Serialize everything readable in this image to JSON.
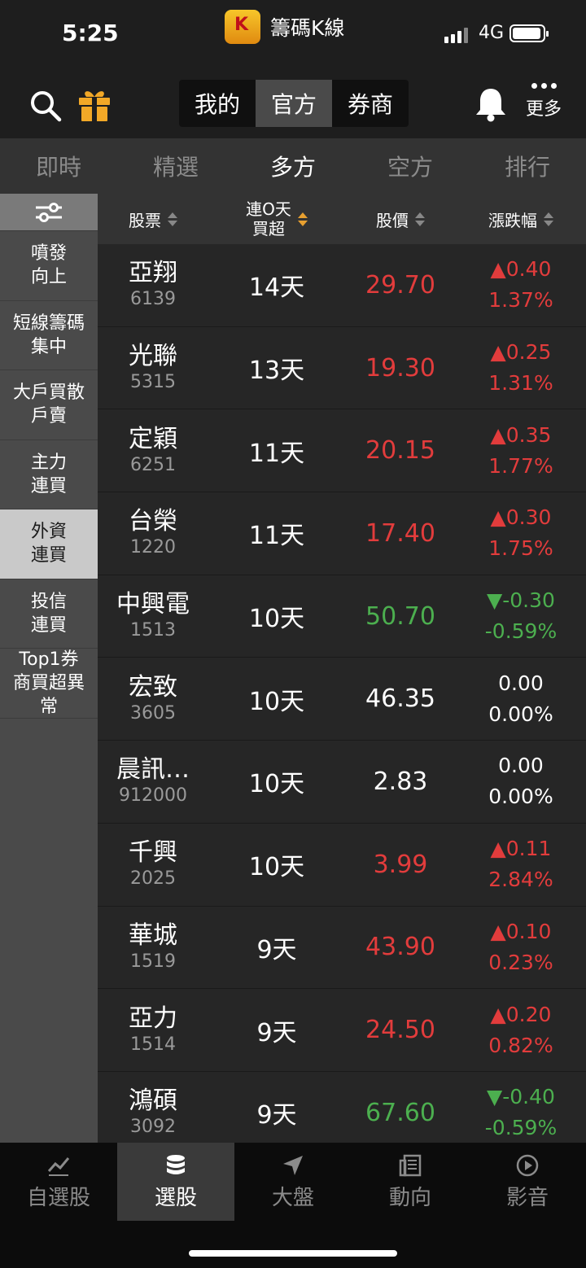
{
  "status": {
    "time": "5:25",
    "app_name": "籌碼K線",
    "network": "4G"
  },
  "header": {
    "segments": [
      {
        "label": "我的"
      },
      {
        "label": "官方",
        "active": true
      },
      {
        "label": "券商"
      }
    ],
    "more_label": "更多"
  },
  "tabs": [
    {
      "label": "即時"
    },
    {
      "label": "精選"
    },
    {
      "label": "多方",
      "active": true
    },
    {
      "label": "空方"
    },
    {
      "label": "排行"
    }
  ],
  "sidebar": [
    {
      "label": "噴發\n向上"
    },
    {
      "label": "短線籌碼\n集中"
    },
    {
      "label": "大戶買散\n戶賣"
    },
    {
      "label": "主力\n連買"
    },
    {
      "label": "外資\n連買",
      "active": true
    },
    {
      "label": "投信\n連買"
    },
    {
      "label": "Top1券\n商買超異\n常"
    }
  ],
  "columns": {
    "stock": "股票",
    "consecutive_line1": "連O天",
    "consecutive_line2": "買超",
    "price": "股價",
    "change": "漲跌幅"
  },
  "rows": [
    {
      "name": "亞翔",
      "code": "6139",
      "days": "14天",
      "price": "29.70",
      "change": "▲0.40",
      "pct": "1.37%",
      "dir": "up"
    },
    {
      "name": "光聯",
      "code": "5315",
      "days": "13天",
      "price": "19.30",
      "change": "▲0.25",
      "pct": "1.31%",
      "dir": "up"
    },
    {
      "name": "定穎",
      "code": "6251",
      "days": "11天",
      "price": "20.15",
      "change": "▲0.35",
      "pct": "1.77%",
      "dir": "up"
    },
    {
      "name": "台榮",
      "code": "1220",
      "days": "11天",
      "price": "17.40",
      "change": "▲0.30",
      "pct": "1.75%",
      "dir": "up"
    },
    {
      "name": "中興電",
      "code": "1513",
      "days": "10天",
      "price": "50.70",
      "change": "▼-0.30",
      "pct": "-0.59%",
      "dir": "down"
    },
    {
      "name": "宏致",
      "code": "3605",
      "days": "10天",
      "price": "46.35",
      "change": "0.00",
      "pct": "0.00%",
      "dir": "flat"
    },
    {
      "name": "晨訊…",
      "code": "912000",
      "days": "10天",
      "price": "2.83",
      "change": "0.00",
      "pct": "0.00%",
      "dir": "flat"
    },
    {
      "name": "千興",
      "code": "2025",
      "days": "10天",
      "price": "3.99",
      "change": "▲0.11",
      "pct": "2.84%",
      "dir": "up"
    },
    {
      "name": "華城",
      "code": "1519",
      "days": "9天",
      "price": "43.90",
      "change": "▲0.10",
      "pct": "0.23%",
      "dir": "up"
    },
    {
      "name": "亞力",
      "code": "1514",
      "days": "9天",
      "price": "24.50",
      "change": "▲0.20",
      "pct": "0.82%",
      "dir": "up"
    },
    {
      "name": "鴻碩",
      "code": "3092",
      "days": "9天",
      "price": "67.60",
      "change": "▼-0.40",
      "pct": "-0.59%",
      "dir": "down"
    }
  ],
  "bottom_nav": [
    {
      "label": "自選股",
      "icon": "chart-line-icon"
    },
    {
      "label": "選股",
      "icon": "database-icon",
      "active": true
    },
    {
      "label": "大盤",
      "icon": "navigation-arrow-icon"
    },
    {
      "label": "動向",
      "icon": "news-icon"
    },
    {
      "label": "影音",
      "icon": "play-icon"
    }
  ]
}
